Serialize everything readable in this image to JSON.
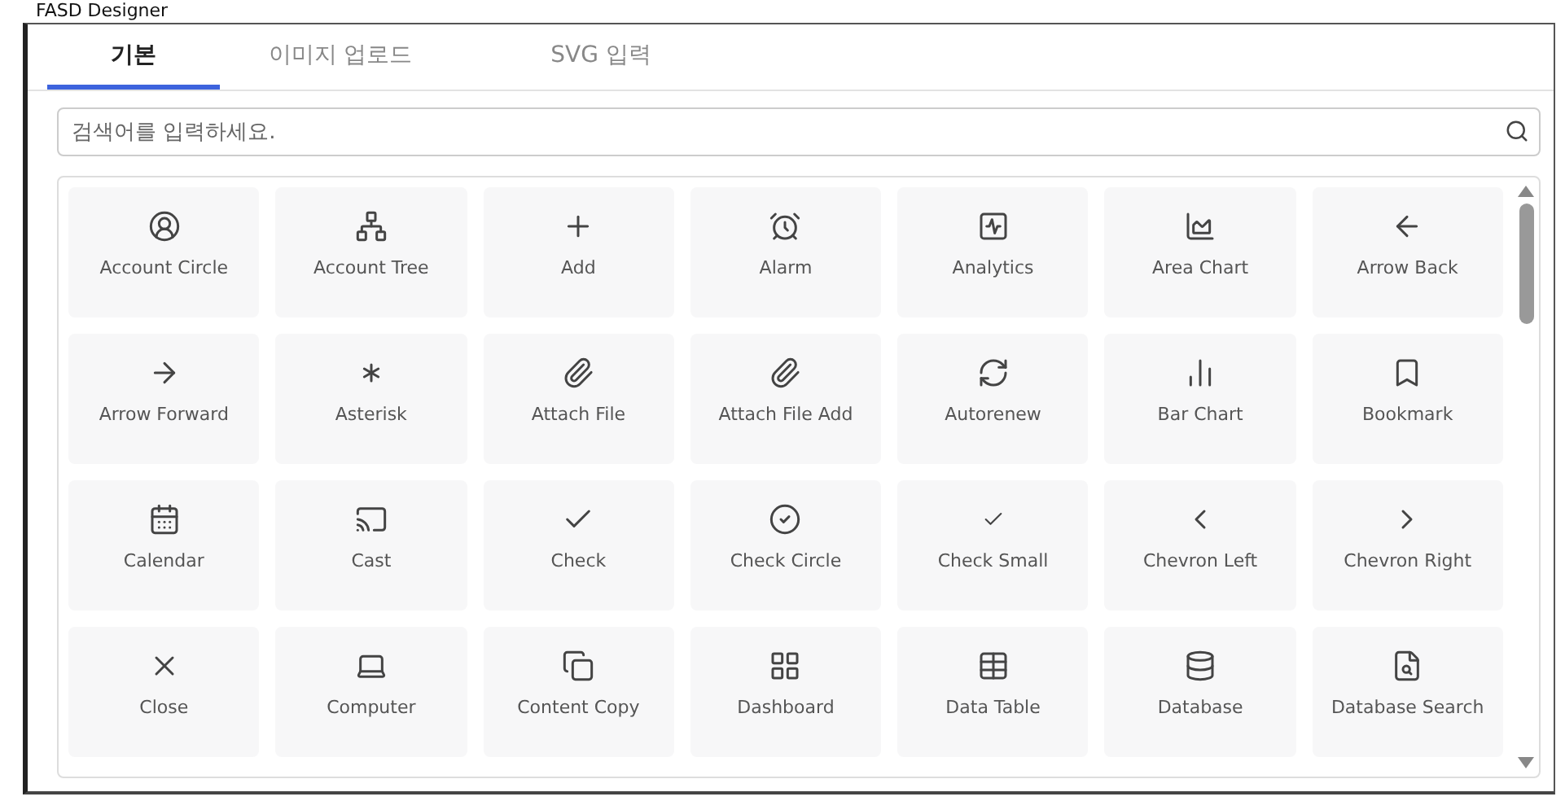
{
  "window": {
    "title": "FASD Designer"
  },
  "tabs": [
    {
      "label": "기본",
      "selected": true
    },
    {
      "label": "이미지 업로드",
      "selected": false
    },
    {
      "label": "SVG 입력",
      "selected": false
    }
  ],
  "search": {
    "placeholder": "검색어를 입력하세요."
  },
  "icons": [
    {
      "label": "Account Circle"
    },
    {
      "label": "Account Tree"
    },
    {
      "label": "Add"
    },
    {
      "label": "Alarm"
    },
    {
      "label": "Analytics"
    },
    {
      "label": "Area Chart"
    },
    {
      "label": "Arrow Back"
    },
    {
      "label": "Arrow Forward"
    },
    {
      "label": "Asterisk"
    },
    {
      "label": "Attach File"
    },
    {
      "label": "Attach File Add"
    },
    {
      "label": "Autorenew"
    },
    {
      "label": "Bar Chart"
    },
    {
      "label": "Bookmark"
    },
    {
      "label": "Calendar"
    },
    {
      "label": "Cast"
    },
    {
      "label": "Check"
    },
    {
      "label": "Check Circle"
    },
    {
      "label": "Check Small"
    },
    {
      "label": "Chevron Left"
    },
    {
      "label": "Chevron Right"
    },
    {
      "label": "Close"
    },
    {
      "label": "Computer"
    },
    {
      "label": "Content Copy"
    },
    {
      "label": "Dashboard"
    },
    {
      "label": "Data Table"
    },
    {
      "label": "Database"
    },
    {
      "label": "Database Search"
    }
  ]
}
